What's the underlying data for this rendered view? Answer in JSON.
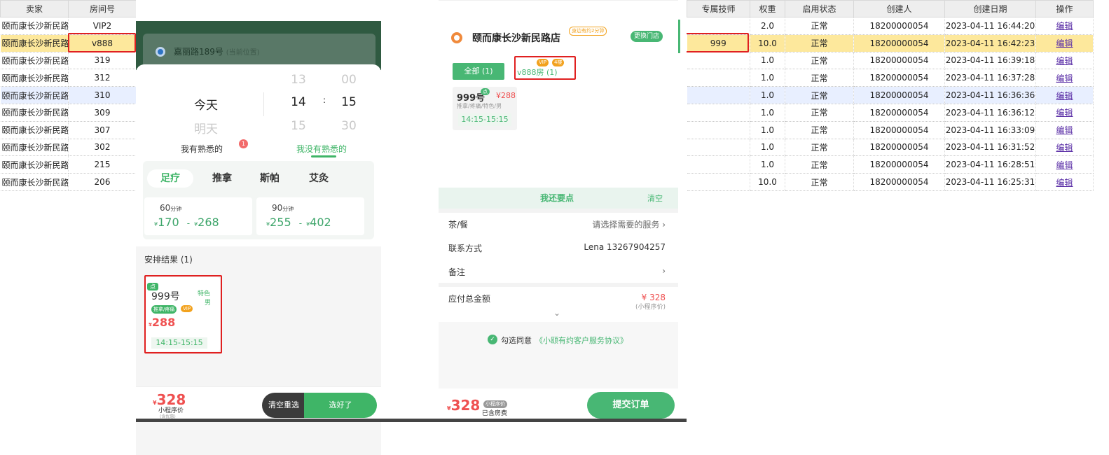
{
  "left_table": {
    "headers": [
      "卖家",
      "房间号"
    ],
    "rows": [
      {
        "seller": "颐而康长沙新民路",
        "room": "VIP2"
      },
      {
        "seller": "颐而康长沙新民路",
        "room": "v888"
      },
      {
        "seller": "颐而康长沙新民路",
        "room": "319"
      },
      {
        "seller": "颐而康长沙新民路",
        "room": "312"
      },
      {
        "seller": "颐而康长沙新民路",
        "room": "310"
      },
      {
        "seller": "颐而康长沙新民路",
        "room": "309"
      },
      {
        "seller": "颐而康长沙新民路",
        "room": "307"
      },
      {
        "seller": "颐而康长沙新民路",
        "room": "302"
      },
      {
        "seller": "颐而康长沙新民路",
        "room": "215"
      },
      {
        "seller": "颐而康长沙新民路",
        "room": "206"
      }
    ]
  },
  "right_table": {
    "headers": [
      "专属技师",
      "权重",
      "启用状态",
      "创建人",
      "创建日期",
      "操作"
    ],
    "rows": [
      {
        "tech": "",
        "weight": "2.0",
        "status": "正常",
        "creator": "18200000054",
        "date": "2023-04-11 16:44:20",
        "action": "编辑"
      },
      {
        "tech": "999",
        "weight": "10.0",
        "status": "正常",
        "creator": "18200000054",
        "date": "2023-04-11 16:42:23",
        "action": "编辑"
      },
      {
        "tech": "",
        "weight": "1.0",
        "status": "正常",
        "creator": "18200000054",
        "date": "2023-04-11 16:39:18",
        "action": "编辑"
      },
      {
        "tech": "",
        "weight": "1.0",
        "status": "正常",
        "creator": "18200000054",
        "date": "2023-04-11 16:37:28",
        "action": "编辑"
      },
      {
        "tech": "",
        "weight": "1.0",
        "status": "正常",
        "creator": "18200000054",
        "date": "2023-04-11 16:36:36",
        "action": "编辑"
      },
      {
        "tech": "",
        "weight": "1.0",
        "status": "正常",
        "creator": "18200000054",
        "date": "2023-04-11 16:36:12",
        "action": "编辑"
      },
      {
        "tech": "",
        "weight": "1.0",
        "status": "正常",
        "creator": "18200000054",
        "date": "2023-04-11 16:33:09",
        "action": "编辑"
      },
      {
        "tech": "",
        "weight": "1.0",
        "status": "正常",
        "creator": "18200000054",
        "date": "2023-04-11 16:31:52",
        "action": "编辑"
      },
      {
        "tech": "",
        "weight": "1.0",
        "status": "正常",
        "creator": "18200000054",
        "date": "2023-04-11 16:28:51",
        "action": "编辑"
      },
      {
        "tech": "",
        "weight": "10.0",
        "status": "正常",
        "creator": "18200000054",
        "date": "2023-04-11 16:25:31",
        "action": "编辑"
      }
    ]
  },
  "left_panel": {
    "location": "嘉丽路189号",
    "location_sub": "(当前位置)",
    "picker": {
      "day_prev": "",
      "day_selected": "今天",
      "day_next": "明天",
      "hour_prev": "13",
      "hour_selected": "14",
      "hour_next": "15",
      "sep": ":",
      "min_prev": "00",
      "min_selected": "15",
      "min_next": "30"
    },
    "familiar_tab": "我有熟悉的",
    "familiar_badge": "1",
    "not_familiar_tab": "我没有熟悉的",
    "service_tabs": [
      "足疗",
      "推拿",
      "斯帕",
      "艾灸"
    ],
    "price_cards": [
      {
        "minutes": "60",
        "unit": "分钟",
        "low": "170",
        "high": "268"
      },
      {
        "minutes": "90",
        "unit": "分钟",
        "low": "255",
        "high": "402"
      }
    ],
    "currency": "¥",
    "dash": "-",
    "result_title": "安排结果 (1)",
    "tech_card": {
      "tag_point": "点",
      "number": "999号",
      "side1": "特色",
      "side2": "男",
      "tag_type": "推拿/疼痛",
      "tag_vip": "VIP",
      "price": "288",
      "time": "14:15-15:15"
    },
    "total": "328",
    "total_label": "小程序价",
    "total_sub": "(含优惠)",
    "btn_clear": "清空重选",
    "btn_ok": "选好了"
  },
  "right_panel": {
    "store_name": "颐而康长沙新民路店",
    "store_tag": "身边有约2分钟",
    "change_store": "更换门店",
    "all_tab": "全部 (1)",
    "room_tab": "v888房 (1)",
    "room_tag_vip": "VIP",
    "room_tag_floor": "4楼",
    "tech": {
      "number": "999号",
      "tag_point": "点",
      "price": "¥288",
      "desc": "推拿/疼痛/特色/男",
      "time": "14:15-15:15"
    },
    "more_title": "我还要点",
    "more_clear": "清空",
    "rows": [
      {
        "label": "茶/餐",
        "value": "请选择需要的服务"
      },
      {
        "label": "联系方式",
        "value": "Lena 13267904257"
      },
      {
        "label": "备注",
        "value": ""
      }
    ],
    "payable_label": "应付总金额",
    "payable_value": "¥ 328",
    "payable_sub": "(小程序价)",
    "agree_text": "勾选同意",
    "agree_link": "《小颐有约客户服务协议》",
    "bottom_total": "328",
    "bottom_tag": "小程序价",
    "bottom_sub": "已含房费",
    "submit": "提交订单"
  }
}
